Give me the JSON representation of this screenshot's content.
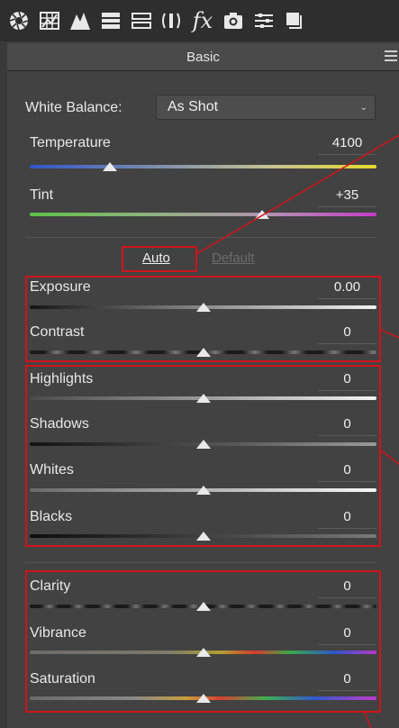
{
  "toolbar": {
    "icons": [
      "aperture-icon",
      "histogram-grid-icon",
      "tone-curve-icon",
      "detail-icon",
      "hsl-icon",
      "split-toning-icon",
      "fx-icon",
      "camera-icon",
      "presets-icon",
      "snapshots-icon"
    ],
    "fx_label": "fx"
  },
  "panel": {
    "title": "Basic"
  },
  "white_balance": {
    "label": "White Balance:",
    "value": "As Shot"
  },
  "sliders": {
    "temperature": {
      "label": "Temperature",
      "value": "4100",
      "position": 0.23
    },
    "tint": {
      "label": "Tint",
      "value": "+35",
      "position": 0.67
    },
    "exposure": {
      "label": "Exposure",
      "value": "0.00",
      "position": 0.5
    },
    "contrast": {
      "label": "Contrast",
      "value": "0",
      "position": 0.5
    },
    "highlights": {
      "label": "Highlights",
      "value": "0",
      "position": 0.5
    },
    "shadows": {
      "label": "Shadows",
      "value": "0",
      "position": 0.5
    },
    "whites": {
      "label": "Whites",
      "value": "0",
      "position": 0.5
    },
    "blacks": {
      "label": "Blacks",
      "value": "0",
      "position": 0.5
    },
    "clarity": {
      "label": "Clarity",
      "value": "0",
      "position": 0.5
    },
    "vibrance": {
      "label": "Vibrance",
      "value": "0",
      "position": 0.5
    },
    "saturation": {
      "label": "Saturation",
      "value": "0",
      "position": 0.5
    }
  },
  "buttons": {
    "auto": "Auto",
    "default": "Default"
  },
  "colors": {
    "annotation_red": "#d0141b",
    "panel_bg": "#424242",
    "toolbar_bg": "#2e2e2e"
  }
}
